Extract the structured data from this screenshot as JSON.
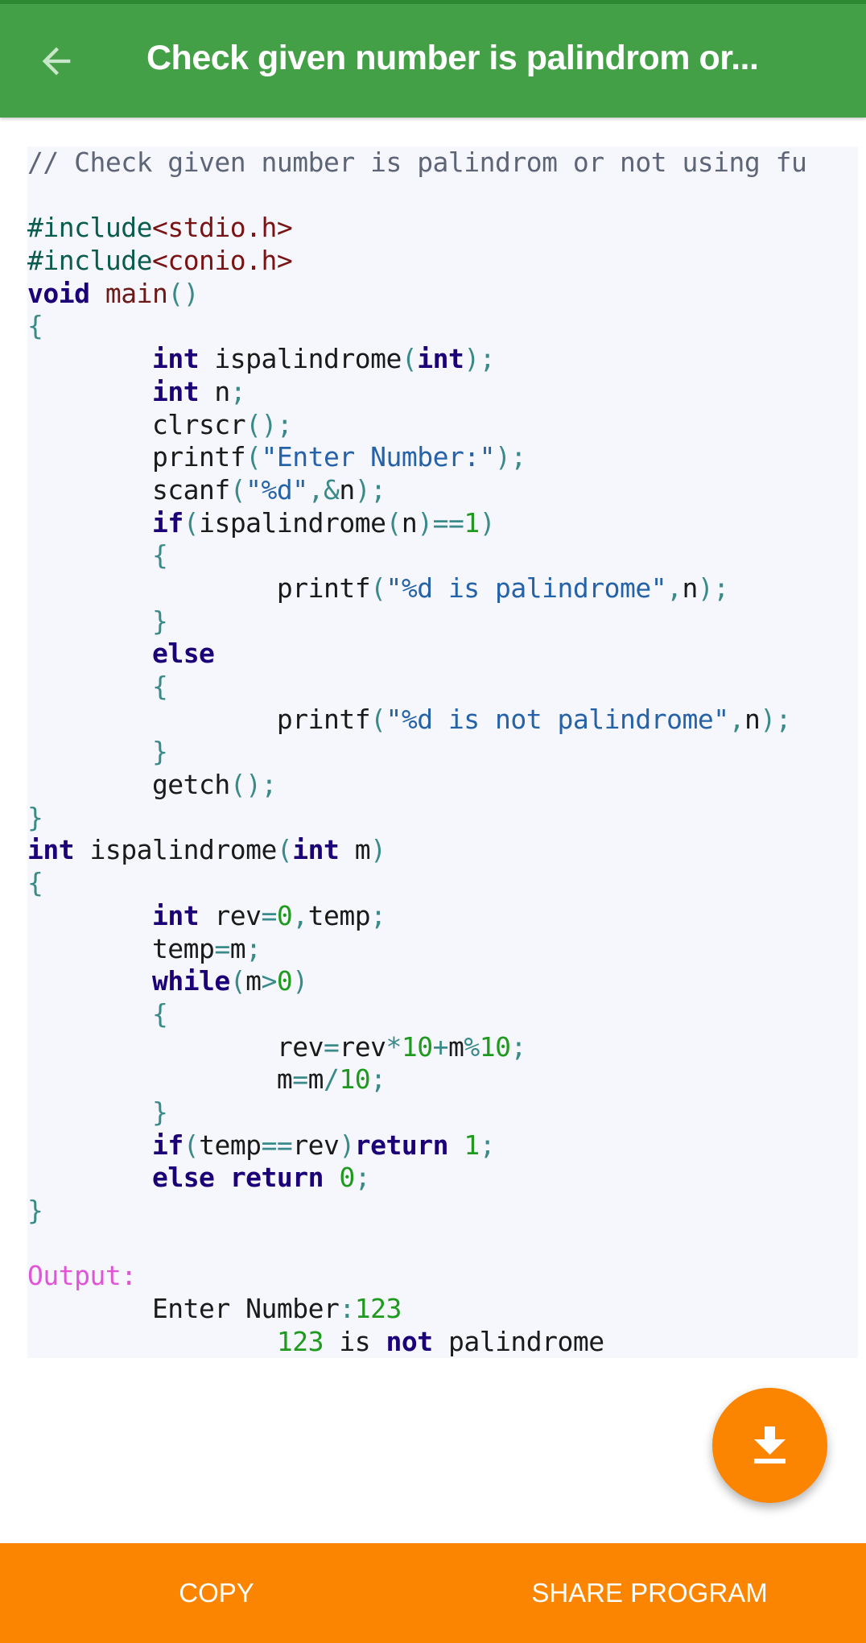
{
  "header": {
    "title": "Check given number is palindrom or...",
    "back_icon": "arrow-back-icon"
  },
  "colors": {
    "appbar": "#43a047",
    "accent": "#fb8500",
    "code_bg": "#f5f7fc"
  },
  "code": {
    "lines": [
      [
        [
          "c",
          "// Check given number is palindrom or not using fu"
        ]
      ],
      [],
      [
        [
          "p",
          "#include"
        ],
        [
          "h",
          "<stdio.h>"
        ]
      ],
      [
        [
          "p",
          "#include"
        ],
        [
          "h",
          "<conio.h>"
        ]
      ],
      [
        [
          "k",
          "void"
        ],
        [
          "n",
          " "
        ],
        [
          "f",
          "main"
        ],
        [
          "o",
          "()"
        ]
      ],
      [
        [
          "o",
          "{"
        ]
      ],
      [
        [
          "n",
          "        "
        ],
        [
          "k",
          "int"
        ],
        [
          "n",
          " ispalindrome"
        ],
        [
          "o",
          "("
        ],
        [
          "k",
          "int"
        ],
        [
          "o",
          ");"
        ]
      ],
      [
        [
          "n",
          "        "
        ],
        [
          "k",
          "int"
        ],
        [
          "n",
          " n"
        ],
        [
          "o",
          ";"
        ]
      ],
      [
        [
          "n",
          "        clrscr"
        ],
        [
          "o",
          "();"
        ]
      ],
      [
        [
          "n",
          "        printf"
        ],
        [
          "o",
          "("
        ],
        [
          "s",
          "\"Enter Number:\""
        ],
        [
          "o",
          ");"
        ]
      ],
      [
        [
          "n",
          "        scanf"
        ],
        [
          "o",
          "("
        ],
        [
          "s",
          "\"%d\""
        ],
        [
          "o",
          ",&"
        ],
        [
          "n",
          "n"
        ],
        [
          "o",
          ");"
        ]
      ],
      [
        [
          "n",
          "        "
        ],
        [
          "k",
          "if"
        ],
        [
          "o",
          "("
        ],
        [
          "n",
          "ispalindrome"
        ],
        [
          "o",
          "("
        ],
        [
          "n",
          "n"
        ],
        [
          "o",
          ")=="
        ],
        [
          "d",
          "1"
        ],
        [
          "o",
          ")"
        ]
      ],
      [
        [
          "n",
          "        "
        ],
        [
          "o",
          "{"
        ]
      ],
      [
        [
          "n",
          "                printf"
        ],
        [
          "o",
          "("
        ],
        [
          "s",
          "\"%d is palindrome\""
        ],
        [
          "o",
          ","
        ],
        [
          "n",
          "n"
        ],
        [
          "o",
          ");"
        ]
      ],
      [
        [
          "n",
          "        "
        ],
        [
          "o",
          "}"
        ]
      ],
      [
        [
          "n",
          "        "
        ],
        [
          "k",
          "else"
        ]
      ],
      [
        [
          "n",
          "        "
        ],
        [
          "o",
          "{"
        ]
      ],
      [
        [
          "n",
          "                printf"
        ],
        [
          "o",
          "("
        ],
        [
          "s",
          "\"%d is not palindrome\""
        ],
        [
          "o",
          ","
        ],
        [
          "n",
          "n"
        ],
        [
          "o",
          ");"
        ]
      ],
      [
        [
          "n",
          "        "
        ],
        [
          "o",
          "}"
        ]
      ],
      [
        [
          "n",
          "        getch"
        ],
        [
          "o",
          "();"
        ]
      ],
      [
        [
          "o",
          "}"
        ]
      ],
      [
        [
          "k",
          "int"
        ],
        [
          "n",
          " ispalindrome"
        ],
        [
          "o",
          "("
        ],
        [
          "k",
          "int"
        ],
        [
          "n",
          " m"
        ],
        [
          "o",
          ")"
        ]
      ],
      [
        [
          "o",
          "{"
        ]
      ],
      [
        [
          "n",
          "        "
        ],
        [
          "k",
          "int"
        ],
        [
          "n",
          " rev"
        ],
        [
          "o",
          "="
        ],
        [
          "d",
          "0"
        ],
        [
          "o",
          ","
        ],
        [
          "n",
          "temp"
        ],
        [
          "o",
          ";"
        ]
      ],
      [
        [
          "n",
          "        temp"
        ],
        [
          "o",
          "="
        ],
        [
          "n",
          "m"
        ],
        [
          "o",
          ";"
        ]
      ],
      [
        [
          "n",
          "        "
        ],
        [
          "k",
          "while"
        ],
        [
          "o",
          "("
        ],
        [
          "n",
          "m"
        ],
        [
          "o",
          ">"
        ],
        [
          "d",
          "0"
        ],
        [
          "o",
          ")"
        ]
      ],
      [
        [
          "n",
          "        "
        ],
        [
          "o",
          "{"
        ]
      ],
      [
        [
          "n",
          "                rev"
        ],
        [
          "o",
          "="
        ],
        [
          "n",
          "rev"
        ],
        [
          "o",
          "*"
        ],
        [
          "d",
          "10"
        ],
        [
          "o",
          "+"
        ],
        [
          "n",
          "m"
        ],
        [
          "o",
          "%"
        ],
        [
          "d",
          "10"
        ],
        [
          "o",
          ";"
        ]
      ],
      [
        [
          "n",
          "                m"
        ],
        [
          "o",
          "="
        ],
        [
          "n",
          "m"
        ],
        [
          "o",
          "/"
        ],
        [
          "d",
          "10"
        ],
        [
          "o",
          ";"
        ]
      ],
      [
        [
          "n",
          "        "
        ],
        [
          "o",
          "}"
        ]
      ],
      [
        [
          "n",
          "        "
        ],
        [
          "k",
          "if"
        ],
        [
          "o",
          "("
        ],
        [
          "n",
          "temp"
        ],
        [
          "o",
          "=="
        ],
        [
          "n",
          "rev"
        ],
        [
          "o",
          ")"
        ],
        [
          "k",
          "return"
        ],
        [
          "n",
          " "
        ],
        [
          "d",
          "1"
        ],
        [
          "o",
          ";"
        ]
      ],
      [
        [
          "n",
          "        "
        ],
        [
          "k",
          "else"
        ],
        [
          "n",
          " "
        ],
        [
          "k",
          "return"
        ],
        [
          "n",
          " "
        ],
        [
          "d",
          "0"
        ],
        [
          "o",
          ";"
        ]
      ],
      [
        [
          "o",
          "}"
        ]
      ],
      [],
      [
        [
          "m",
          "Output:"
        ]
      ],
      [
        [
          "n",
          "        Enter Number"
        ],
        [
          "o",
          ":"
        ],
        [
          "d",
          "123"
        ]
      ],
      [
        [
          "n",
          "                "
        ],
        [
          "d",
          "123"
        ],
        [
          "n",
          " is "
        ],
        [
          "k",
          "not"
        ],
        [
          "n",
          " palindrome"
        ]
      ]
    ]
  },
  "fab": {
    "icon": "download-icon"
  },
  "bottom_bar": {
    "copy_label": "COPY",
    "share_label": "SHARE PROGRAM"
  }
}
